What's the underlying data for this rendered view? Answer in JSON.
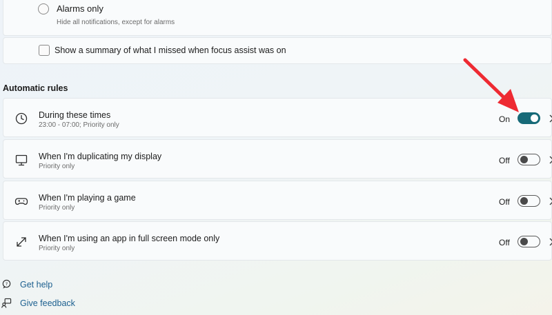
{
  "focus_options": {
    "alarms_only_title": "Alarms only",
    "alarms_only_desc": "Hide all notifications, except for alarms",
    "summary_label": "Show a summary of what I missed when focus assist was on"
  },
  "automatic_rules": {
    "section_title": "Automatic rules",
    "rules": [
      {
        "title": "During these times",
        "subtitle": "23:00 - 07:00; Priority only",
        "state": "On",
        "enabled": true,
        "icon": "clock-icon"
      },
      {
        "title": "When I'm duplicating my display",
        "subtitle": "Priority only",
        "state": "Off",
        "enabled": false,
        "icon": "monitor-icon"
      },
      {
        "title": "When I'm playing a game",
        "subtitle": "Priority only",
        "state": "Off",
        "enabled": false,
        "icon": "gamepad-icon"
      },
      {
        "title": "When I'm using an app in full screen mode only",
        "subtitle": "Priority only",
        "state": "Off",
        "enabled": false,
        "icon": "expand-icon"
      }
    ]
  },
  "footer_links": {
    "get_help": "Get help",
    "give_feedback": "Give feedback"
  },
  "colors": {
    "toggle_on": "#176a78",
    "annotation_arrow": "#ee2a32",
    "link": "#1c5f8f"
  }
}
